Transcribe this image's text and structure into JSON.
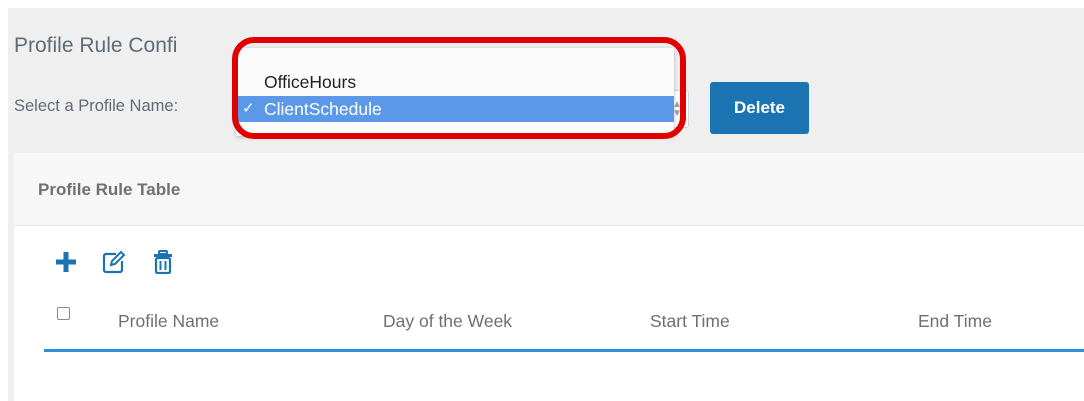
{
  "config": {
    "title": "Profile Rule Confi",
    "select_label": "Select a Profile Name:",
    "delete_label": "Delete",
    "dropdown_options": [
      "OfficeHours",
      "ClientSchedule"
    ],
    "selected_option": "ClientSchedule",
    "checkmark": "✓"
  },
  "table": {
    "title": "Profile Rule Table",
    "columns": [
      "Profile Name",
      "Day of the Week",
      "Start Time",
      "End Time"
    ],
    "toolbar_icons": [
      "plus-icon",
      "edit-icon",
      "trash-icon"
    ]
  },
  "colors": {
    "accent": "#1b73b2",
    "highlight": "#e00000",
    "selected_option": "#5b98e8",
    "table_rule": "#2d8fd5"
  }
}
